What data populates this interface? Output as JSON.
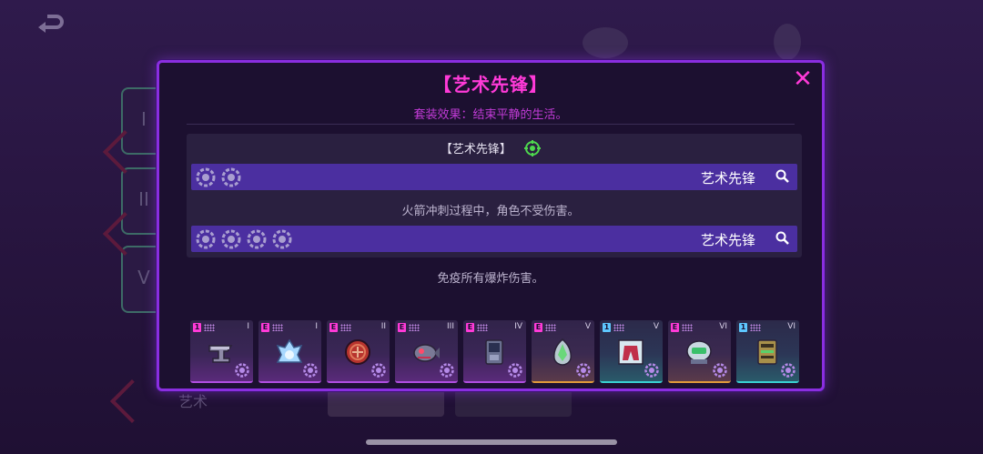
{
  "modal": {
    "title": "【艺术先锋】",
    "set_effect": "套装效果：结束平静的生活。",
    "set_name": "【艺术先锋】",
    "bonuses": [
      {
        "pieces": 2,
        "label": "艺术先锋",
        "description": "火箭冲刺过程中，角色不受伤害。"
      },
      {
        "pieces": 4,
        "label": "艺术先锋",
        "description": "免疫所有爆炸伤害。"
      }
    ],
    "items": [
      {
        "badge": "1",
        "badge_color": "pink",
        "tier": "I",
        "icon": "anvil-icon",
        "rarity": "purple"
      },
      {
        "badge": "E",
        "badge_color": "pink",
        "tier": "I",
        "icon": "spirit-icon",
        "rarity": "purple"
      },
      {
        "badge": "E",
        "badge_color": "pink",
        "tier": "II",
        "icon": "shield-orb-icon",
        "rarity": "purple"
      },
      {
        "badge": "E",
        "badge_color": "pink",
        "tier": "III",
        "icon": "robot-fish-icon",
        "rarity": "purple"
      },
      {
        "badge": "E",
        "badge_color": "pink",
        "tier": "IV",
        "icon": "phone-device-icon",
        "rarity": "purple"
      },
      {
        "badge": "E",
        "badge_color": "pink",
        "tier": "V",
        "icon": "crystal-egg-icon",
        "rarity": "orange"
      },
      {
        "badge": "1",
        "badge_color": "blue",
        "tier": "V",
        "icon": "jacket-card-icon",
        "rarity": "teal"
      },
      {
        "badge": "E",
        "badge_color": "pink",
        "tier": "VI",
        "icon": "helmet-bot-icon",
        "rarity": "orange"
      },
      {
        "badge": "1",
        "badge_color": "blue",
        "tier": "VI",
        "icon": "book-device-icon",
        "rarity": "teal"
      }
    ]
  },
  "background": {
    "bottom_label": "艺术",
    "tabs": [
      "I",
      "II",
      "V"
    ]
  },
  "colors": {
    "accent": "#ff3ad8",
    "frame": "#8a2ee0",
    "bar": "#4b2fa0"
  }
}
